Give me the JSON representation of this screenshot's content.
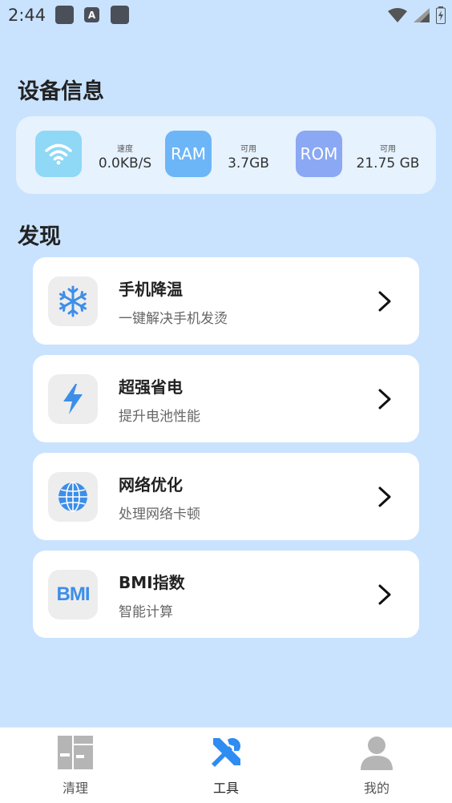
{
  "status_bar": {
    "time": "2:44",
    "notif_icons": [
      "app-icon",
      "a-app-icon",
      "app-icon"
    ]
  },
  "device_section": {
    "title": "设备信息",
    "speed": {
      "label": "速度",
      "value": "0.0KB/S",
      "icon": "wifi-icon"
    },
    "ram": {
      "tile_text": "RAM",
      "label": "可用",
      "value": "3.7GB"
    },
    "rom": {
      "tile_text": "ROM",
      "label": "可用",
      "value": "21.75 GB"
    },
    "colors": {
      "wifi_tile": "#8fd8f6",
      "ram_tile": "#6cb6f7",
      "rom_tile": "#8aa8f3"
    }
  },
  "discover_section": {
    "title": "发现",
    "items": [
      {
        "title": "手机降温",
        "subtitle": "一键解决手机发烫",
        "icon": "snowflake-icon"
      },
      {
        "title": "超强省电",
        "subtitle": "提升电池性能",
        "icon": "lightning-icon"
      },
      {
        "title": "网络优化",
        "subtitle": "处理网络卡顿",
        "icon": "globe-icon"
      },
      {
        "title": "BMI指数",
        "subtitle": "智能计算",
        "icon": "bmi-icon",
        "icon_text": "BMI"
      }
    ]
  },
  "bottom_nav": {
    "items": [
      {
        "label": "清理",
        "icon": "dashboard-icon",
        "active": false
      },
      {
        "label": "工具",
        "icon": "tools-icon",
        "active": true
      },
      {
        "label": "我的",
        "icon": "person-icon",
        "active": false
      }
    ]
  },
  "colors": {
    "background": "#c9e3fe",
    "accent": "#2f8cf0"
  }
}
